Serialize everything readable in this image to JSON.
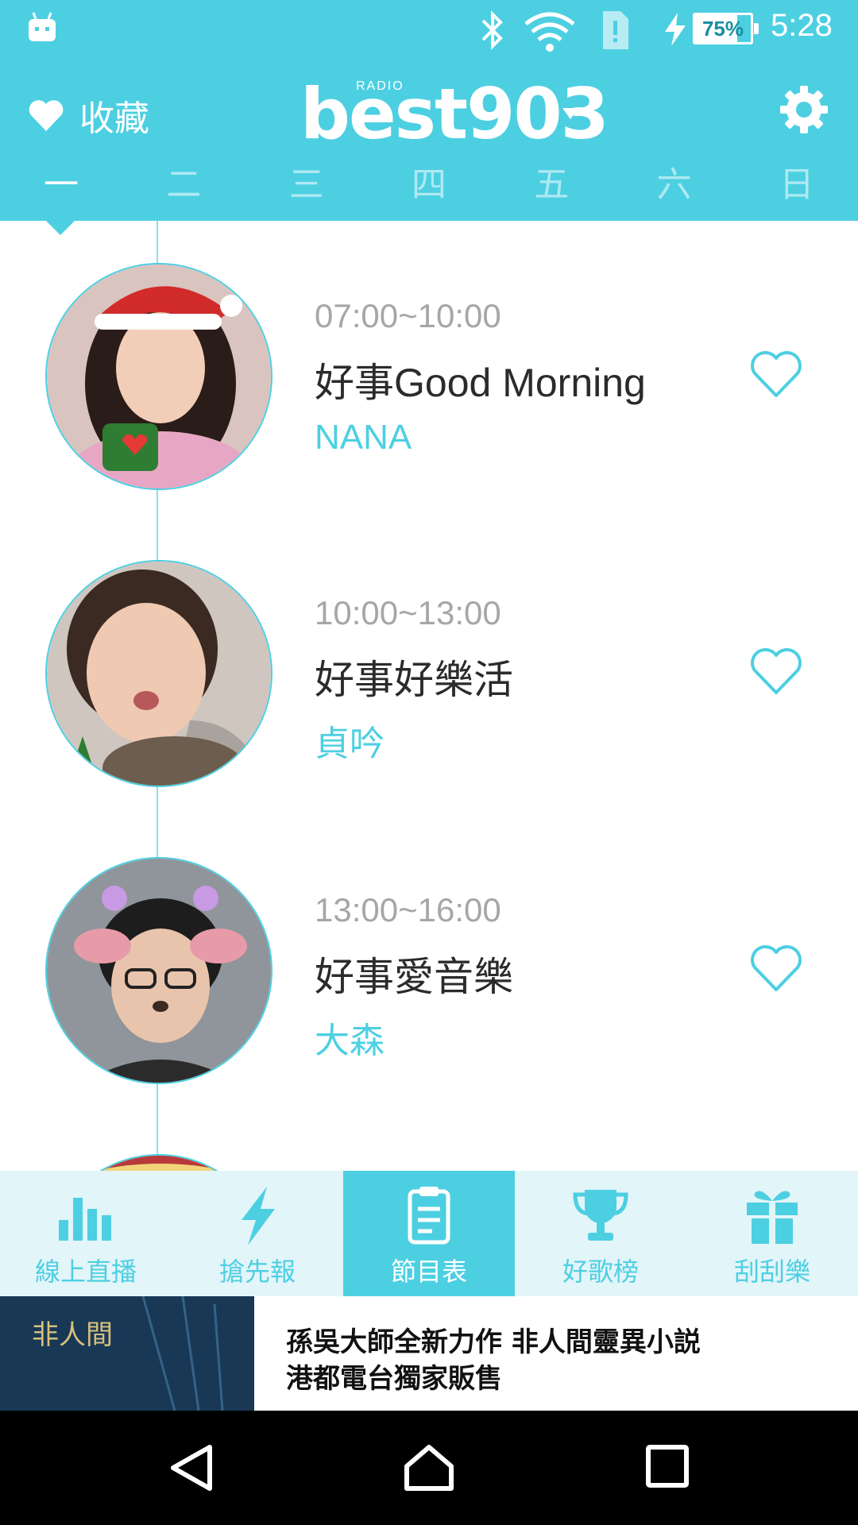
{
  "status_bar": {
    "battery_percent": "75%",
    "battery_level": 0.75,
    "time": "5:28",
    "icons": [
      "android-icon",
      "bluetooth-icon",
      "wifi-icon",
      "sim-alert-icon",
      "charging-icon",
      "battery-icon"
    ]
  },
  "header": {
    "favorites_label": "收藏",
    "logo_radio": "RADIO",
    "logo_text": "best903",
    "days": [
      "一",
      "二",
      "三",
      "四",
      "五",
      "六",
      "日"
    ],
    "active_day": "一"
  },
  "schedule": [
    {
      "time": "07:00~10:00",
      "title": "好事Good Morning",
      "host": "NANA"
    },
    {
      "time": "10:00~13:00",
      "title": "好事好樂活",
      "host": "貞吟"
    },
    {
      "time": "13:00~16:00",
      "title": "好事愛音樂",
      "host": "大森"
    }
  ],
  "tabs": [
    {
      "label": "線上直播",
      "icon": "bar-chart-icon"
    },
    {
      "label": "搶先報",
      "icon": "lightning-icon"
    },
    {
      "label": "節目表",
      "icon": "clipboard-icon",
      "active": true
    },
    {
      "label": "好歌榜",
      "icon": "trophy-icon"
    },
    {
      "label": "刮刮樂",
      "icon": "gift-icon"
    }
  ],
  "ad": {
    "line1": "孫吳大師全新力作 非人間靈異小説",
    "line2": "港都電台獨家販售",
    "image_text": "非人間"
  },
  "colors": {
    "accent": "#4dcfe2",
    "tab_bg": "#e2f5f9",
    "title": "#2b2b2b",
    "time": "#a6a6a6"
  }
}
